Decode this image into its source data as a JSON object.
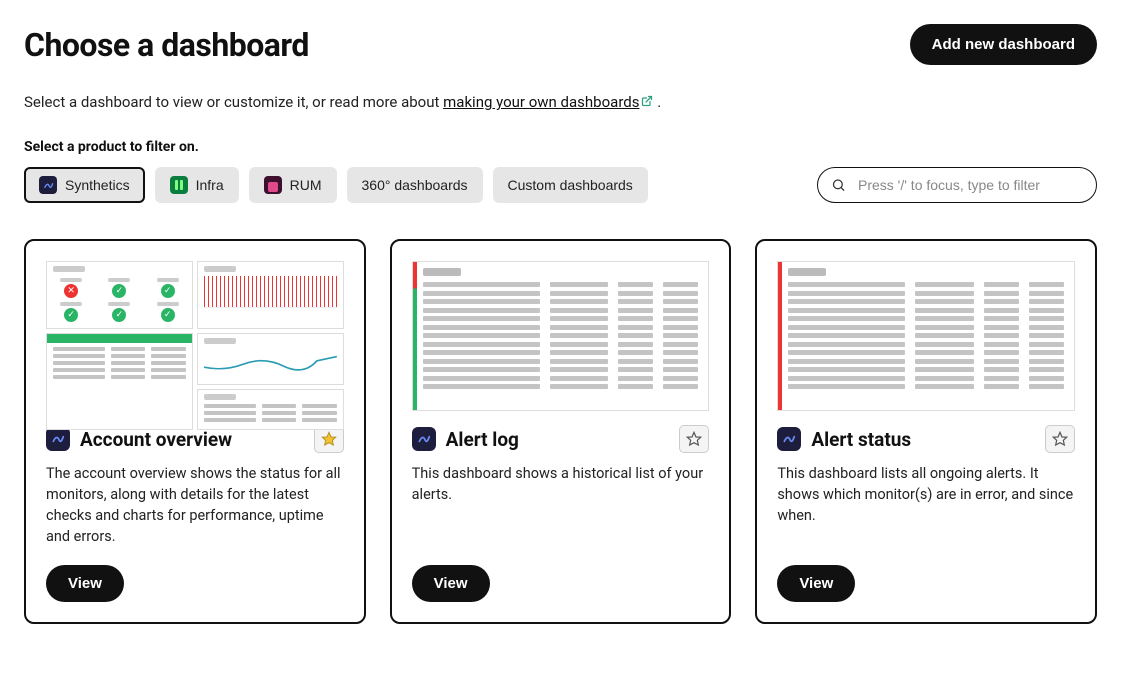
{
  "header": {
    "title": "Choose a dashboard",
    "add_button": "Add new dashboard"
  },
  "subtitle": {
    "prefix": "Select a dashboard to view or customize it, or read more about ",
    "link_text": "making your own dashboards",
    "suffix": " ."
  },
  "filters": {
    "label": "Select a product to filter on.",
    "items": [
      {
        "label": "Synthetics",
        "active": true,
        "icon": "synth"
      },
      {
        "label": "Infra",
        "active": false,
        "icon": "infra"
      },
      {
        "label": "RUM",
        "active": false,
        "icon": "rum"
      },
      {
        "label": "360° dashboards",
        "active": false,
        "icon": null
      },
      {
        "label": "Custom dashboards",
        "active": false,
        "icon": null
      }
    ]
  },
  "search": {
    "placeholder": "Press '/' to focus, type to filter"
  },
  "cards": [
    {
      "title": "Account overview",
      "description": "The account overview shows the status for all monitors, along with details for the latest checks and charts for performance, uptime and errors.",
      "view_label": "View",
      "favorited": true
    },
    {
      "title": "Alert log",
      "description": "This dashboard shows a historical list of your alerts.",
      "view_label": "View",
      "favorited": false
    },
    {
      "title": "Alert status",
      "description": "This dashboard lists all ongoing alerts. It shows which monitor(s) are in error, and since when.",
      "view_label": "View",
      "favorited": false
    }
  ]
}
